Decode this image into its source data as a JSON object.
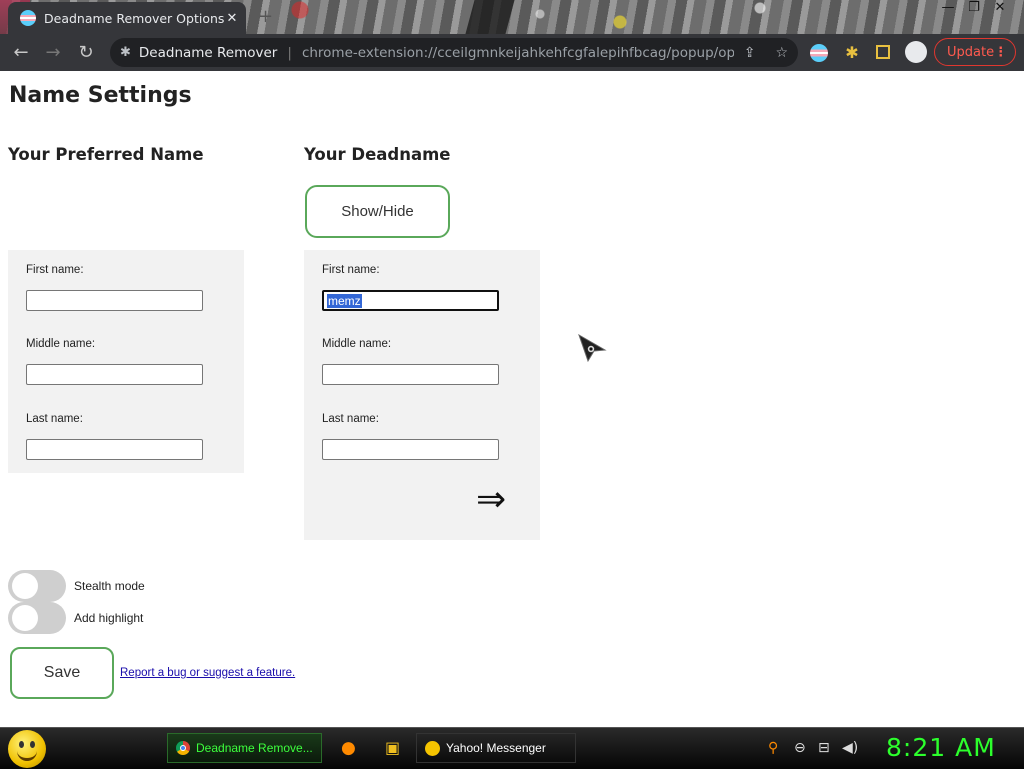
{
  "browser": {
    "tab_title": "Deadname Remover Options",
    "tab_close": "✕",
    "new_tab": "+",
    "omnibox_site": "Deadname Remover",
    "omnibox_url": "chrome-extension://cceilgmnkeijahkehfcgfalepihfbcag/popup/options...",
    "update_label": "Update",
    "update_menu": "⋮",
    "back": "←",
    "forward": "→",
    "reload": "↻",
    "minimize": "—",
    "restore": "❐",
    "close_window": "✕"
  },
  "page": {
    "title": "Name Settings",
    "preferred": {
      "heading": "Your Preferred Name",
      "first_label": "First name:",
      "first_value": "",
      "middle_label": "Middle name:",
      "middle_value": "",
      "last_label": "Last name:",
      "last_value": ""
    },
    "deadname": {
      "heading": "Your Deadname",
      "show_hide_label": "Show/Hide",
      "first_label": "First name:",
      "first_value": "memz",
      "middle_label": "Middle name:",
      "middle_value": "",
      "last_label": "Last name:",
      "last_value": "",
      "arrow": "⇒"
    },
    "toggles": [
      {
        "label": "Stealth mode",
        "on": false
      },
      {
        "label": "Add highlight",
        "on": false
      }
    ],
    "save_label": "Save",
    "report_link": "Report a bug or suggest a feature."
  },
  "taskbar": {
    "items": [
      {
        "label": "Deadname Remove..."
      },
      {
        "label": "Yahoo! Messenger"
      }
    ],
    "clock": "8:21 AM"
  },
  "colors": {
    "accent_green": "#5aa85a",
    "selection_blue": "#3367d6",
    "clock_green": "#2cff2c",
    "update_red": "#e0372f"
  }
}
